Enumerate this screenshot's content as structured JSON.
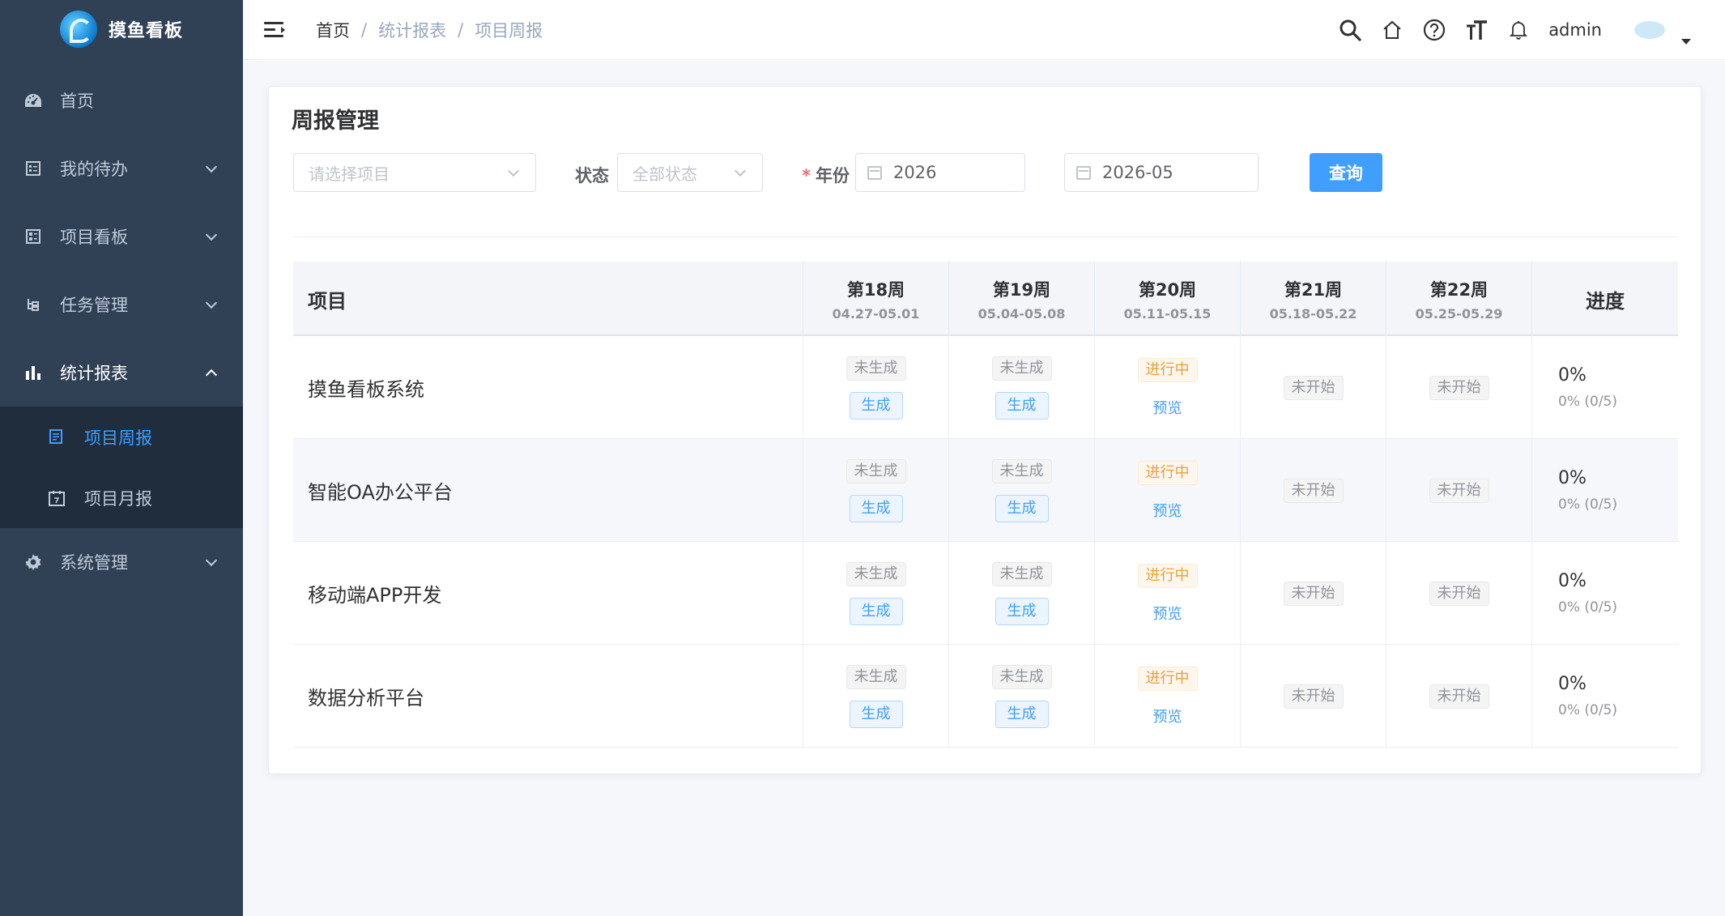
{
  "app": {
    "title": "摸鱼看板"
  },
  "sidebar": {
    "items": [
      {
        "label": "首页",
        "icon": "dashboard-icon"
      },
      {
        "label": "我的待办",
        "icon": "list-icon"
      },
      {
        "label": "项目看板",
        "icon": "board-icon"
      },
      {
        "label": "任务管理",
        "icon": "tree-icon"
      },
      {
        "label": "统计报表",
        "icon": "bar-chart-icon"
      },
      {
        "label": "系统管理",
        "icon": "gear-icon"
      }
    ],
    "submenu": [
      {
        "label": "项目周报",
        "icon": "document-icon",
        "active": true
      },
      {
        "label": "项目月报",
        "icon": "calendar-icon",
        "active": false
      }
    ],
    "bg_color": "#304156",
    "active_color": "#409eff"
  },
  "header": {
    "breadcrumb": [
      "首页",
      "统计报表",
      "项目周报"
    ],
    "breadcrumb_separator": "/",
    "user": "admin",
    "icons": [
      "search-icon",
      "home-icon",
      "help-icon",
      "font-size-icon",
      "bell-icon"
    ]
  },
  "page": {
    "title": "周报管理",
    "filters": {
      "project_placeholder": "请选择项目",
      "status_label": "状态",
      "status_value": "全部状态",
      "year_label": "年份",
      "year_required_mark": "*",
      "year_value": "2026",
      "month_value": "2026-05",
      "query_button": "查询"
    },
    "table": {
      "project_header": "项目",
      "progress_header": "进度",
      "weeks": [
        {
          "name": "第18周",
          "range": "04.27-05.01"
        },
        {
          "name": "第19周",
          "range": "05.04-05.08"
        },
        {
          "name": "第20周",
          "range": "05.11-05.15"
        },
        {
          "name": "第21周",
          "range": "05.18-05.22"
        },
        {
          "name": "第22周",
          "range": "05.25-05.29"
        }
      ],
      "labels": {
        "not_generated": "未生成",
        "generate": "生成",
        "in_progress": "进行中",
        "preview": "预览",
        "not_started": "未开始"
      },
      "rows": [
        {
          "project": "摸鱼看板系统",
          "progress": "0%",
          "progress_detail": "0% (0/5)"
        },
        {
          "project": "智能OA办公平台",
          "progress": "0%",
          "progress_detail": "0% (0/5)"
        },
        {
          "project": "移动端APP开发",
          "progress": "0%",
          "progress_detail": "0% (0/5)"
        },
        {
          "project": "数据分析平台",
          "progress": "0%",
          "progress_detail": "0% (0/5)"
        }
      ]
    }
  }
}
